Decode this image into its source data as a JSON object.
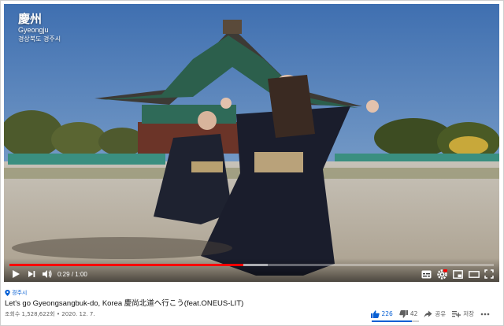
{
  "video": {
    "location_badge": {
      "hanja": "慶州",
      "romanized": "Gyeongju",
      "korean": "경상북도 경주시"
    },
    "player": {
      "time_current": "0:29",
      "time_total": "1:00",
      "time_separator": "/",
      "progress_fraction": 0.483,
      "buffered_fraction": 0.05,
      "accent_color": "#ff0000"
    }
  },
  "meta": {
    "channel_tag": "경주시",
    "title": "Let's go Gyeongsangbuk-do, Korea 慶尚北道へ行こう(feat.ONEUS-LIT)",
    "views": "조회수 1,528,622회",
    "separator": "•",
    "date": "2020. 12. 7.",
    "likes": "226",
    "dislikes": "42",
    "like_ratio": 0.843,
    "share_label": "공유",
    "save_label": "저장",
    "link_color": "#065fd4"
  },
  "icons": [
    "location-pin-icon",
    "play-icon",
    "next-icon",
    "volume-icon",
    "subtitles-icon",
    "settings-icon",
    "miniplayer-icon",
    "theater-icon",
    "fullscreen-icon",
    "thumbs-up-icon",
    "thumbs-down-icon",
    "share-icon",
    "save-icon",
    "more-icon"
  ]
}
